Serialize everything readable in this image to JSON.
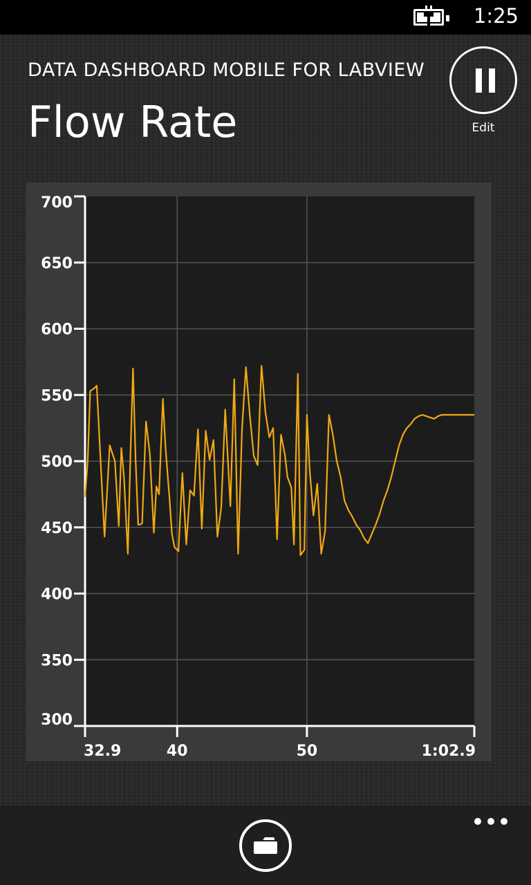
{
  "status": {
    "time": "1:25"
  },
  "header": {
    "app_title": "DATA DASHBOARD MOBILE FOR LABVIEW",
    "page_title": "Flow Rate"
  },
  "edit_button": {
    "label": "Edit"
  },
  "colors": {
    "accent": "#f0a814",
    "plot_bg": "#1c1c1c",
    "frame": "#3a3a3a",
    "grid": "#5a5a5a"
  },
  "icons": {
    "pause": "pause-icon",
    "folder": "folder-icon",
    "more": "more-icon",
    "battery": "battery-charging-icon"
  },
  "chart_data": {
    "type": "line",
    "y_ticks": [
      {
        "label": "700",
        "value": 700
      },
      {
        "label": "650",
        "value": 650
      },
      {
        "label": "600",
        "value": 600
      },
      {
        "label": "550",
        "value": 550
      },
      {
        "label": "500",
        "value": 500
      },
      {
        "label": "450",
        "value": 450
      },
      {
        "label": "400",
        "value": 400
      },
      {
        "label": "350",
        "value": 350
      },
      {
        "label": "300",
        "value": 300
      }
    ],
    "x_ticks": [
      {
        "label": "32.9",
        "value": 32.9
      },
      {
        "label": "40",
        "value": 40
      },
      {
        "label": "50",
        "value": 50
      },
      {
        "label": "1:02.9",
        "value": 62.9
      }
    ],
    "xlim": [
      32.9,
      62.9
    ],
    "ylim": [
      300,
      700
    ],
    "grid": true,
    "series": [
      {
        "color": "#f0a814",
        "x": [
          32.9,
          33.1,
          33.3,
          33.6,
          33.8,
          34.1,
          34.4,
          34.8,
          35.2,
          35.5,
          35.7,
          35.9,
          36.2,
          36.4,
          36.6,
          36.8,
          37.0,
          37.1,
          37.3,
          37.6,
          37.9,
          38.2,
          38.4,
          38.6,
          38.9,
          39.1,
          39.4,
          39.6,
          39.8,
          40.1,
          40.4,
          40.7,
          41.0,
          41.3,
          41.6,
          41.9,
          42.2,
          42.5,
          42.8,
          43.1,
          43.4,
          43.7,
          44.1,
          44.4,
          44.7,
          45.0,
          45.3,
          45.6,
          45.9,
          46.2,
          46.5,
          46.8,
          47.1,
          47.4,
          47.7,
          48.0,
          48.3,
          48.5,
          48.8,
          49.0,
          49.3,
          49.5,
          49.8,
          50.0,
          50.2,
          50.5,
          50.8,
          51.1,
          51.4,
          51.7,
          52.0,
          52.3,
          52.6,
          52.9,
          53.2,
          53.5,
          53.8,
          54.1,
          54.4,
          54.7,
          55.0,
          55.3,
          55.6,
          55.9,
          56.2,
          56.5,
          56.8,
          57.1,
          57.4,
          57.7,
          58.0,
          58.3,
          58.6,
          58.9,
          59.2,
          59.5,
          59.8,
          60.1,
          60.4,
          60.7,
          61.0,
          61.3,
          61.6,
          61.9,
          62.2,
          62.5,
          62.7,
          62.9
        ],
        "y": [
          473,
          500,
          553,
          555,
          557,
          500,
          443,
          512,
          500,
          451,
          510,
          488,
          430,
          505,
          570,
          500,
          452,
          452,
          453,
          530,
          505,
          446,
          481,
          475,
          547,
          510,
          473,
          445,
          435,
          432,
          491,
          437,
          478,
          474,
          524,
          449,
          523,
          501,
          516,
          443,
          465,
          539,
          466,
          562,
          430,
          525,
          571,
          535,
          504,
          497,
          572,
          537,
          518,
          525,
          441,
          520,
          505,
          488,
          480,
          437,
          566,
          429,
          433,
          535,
          495,
          459,
          483,
          430,
          447,
          535,
          520,
          500,
          488,
          470,
          463,
          458,
          452,
          448,
          442,
          438,
          445,
          452,
          460,
          470,
          478,
          488,
          500,
          512,
          520,
          525,
          528,
          532,
          534,
          535,
          534,
          533,
          532,
          534,
          535,
          535,
          535,
          535,
          535,
          535,
          535,
          535,
          535,
          535
        ]
      }
    ]
  }
}
